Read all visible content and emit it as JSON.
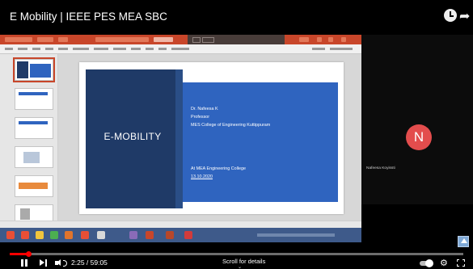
{
  "video": {
    "title": "E Mobility | IEEE PES MEA SBC",
    "time_display": "2:25 / 59:05",
    "progress_fraction": 0.041,
    "scroll_hint": "Scroll for details"
  },
  "slide": {
    "title": "E-MOBILITY",
    "presenter": "Dr. Nafeesa K",
    "role": "Professor",
    "institution": "MES College of Engineering Kuttippuram",
    "venue": "At MEA Engineering College",
    "date": "13.10.2020"
  },
  "participant": {
    "initial": "N",
    "name": "Nafeesa Koyissti",
    "avatar_color": "#e34d4d"
  },
  "colors": {
    "accent_red": "#ff0000",
    "slide_dark": "#1f3a67",
    "slide_blue": "#2f64bf",
    "ppt_orange": "#c8462a"
  },
  "icons": {
    "watch_later": "clock-icon",
    "share": "share-icon",
    "play_pause": "pause-icon",
    "next": "next-icon",
    "volume": "volume-icon",
    "settings": "gear-icon",
    "fullscreen": "fullscreen-icon"
  }
}
